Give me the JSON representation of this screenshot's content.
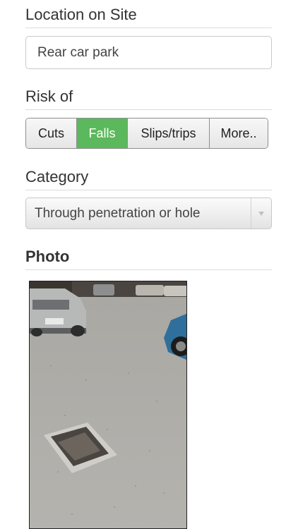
{
  "location": {
    "label": "Location on Site",
    "value": "Rear car park"
  },
  "risk": {
    "label": "Risk of",
    "options": [
      "Cuts",
      "Falls",
      "Slips/trips",
      "More.."
    ],
    "selected": "Falls"
  },
  "category": {
    "label": "Category",
    "value": "Through penetration or hole"
  },
  "photo": {
    "label": "Photo"
  },
  "colors": {
    "accent": "#5cb85c"
  }
}
